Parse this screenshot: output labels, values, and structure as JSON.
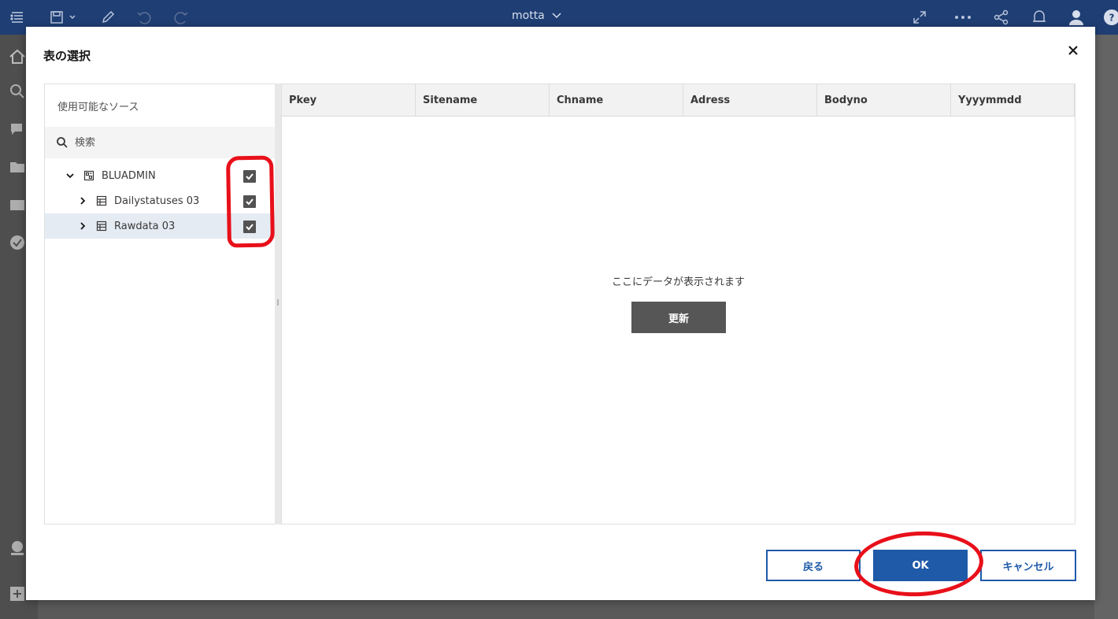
{
  "app": {
    "title": "motta"
  },
  "topbar_icons": [
    "menu-list-icon",
    "save-icon",
    "pencil-icon",
    "undo-icon",
    "redo-icon",
    "expand-icon",
    "more-icon",
    "share-icon",
    "bell-icon",
    "user-icon",
    "help-icon"
  ],
  "leftnav_icons": [
    "home-icon",
    "search-icon",
    "chat-icon",
    "folder-icon",
    "people-icon",
    "check-icon",
    "checklist-icon",
    "add-icon"
  ],
  "dialog": {
    "title": "表の選択",
    "source_pane": {
      "title": "使用可能なソース",
      "search_placeholder": "検索",
      "tree": [
        {
          "label": "BLUADMIN",
          "expanded": true,
          "level": 0,
          "icon": "schema-icon",
          "checked": true
        },
        {
          "label": "Dailystatuses 03",
          "expanded": false,
          "level": 1,
          "icon": "table-icon",
          "checked": true
        },
        {
          "label": "Rawdata 03",
          "expanded": false,
          "level": 1,
          "icon": "table-icon",
          "checked": true,
          "selected": true
        }
      ]
    },
    "preview": {
      "columns": [
        "Pkey",
        "Sitename",
        "Chname",
        "Adress",
        "Bodyno",
        "Yyyymmdd"
      ],
      "empty_message": "ここにデータが表示されます",
      "refresh_label": "更新"
    },
    "buttons": {
      "back": "戻る",
      "ok": "OK",
      "cancel": "キャンセル"
    }
  },
  "colors": {
    "topbar": "#1f3e74",
    "primary": "#1f5aa8",
    "annotation": "#e8101a",
    "checkbox": "#525252"
  }
}
